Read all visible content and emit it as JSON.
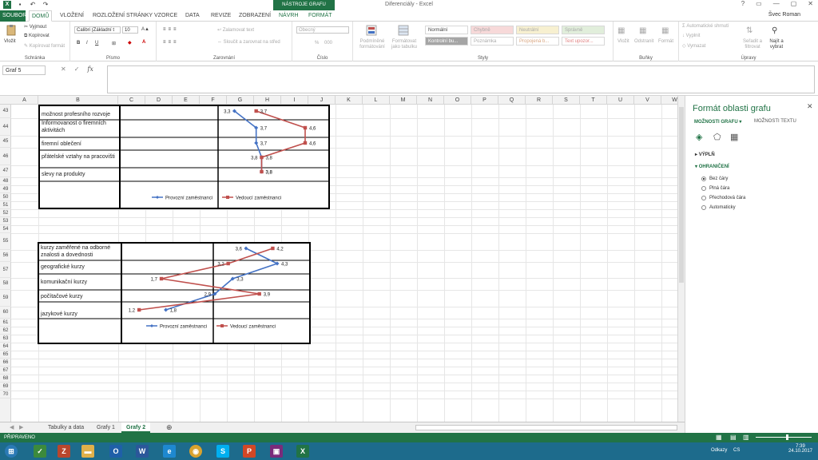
{
  "window": {
    "title": "Diferenciály - Excel",
    "context_tab": "NÁSTROJE GRAFU",
    "user": "Švec Roman",
    "controls": [
      "?",
      "▭",
      "—",
      "▢",
      "✕"
    ]
  },
  "tabs": [
    {
      "label": "SOUBOR"
    },
    {
      "label": "DOMŮ"
    },
    {
      "label": "VLOŽENÍ"
    },
    {
      "label": "ROZLOŽENÍ STRÁNKY"
    },
    {
      "label": "VZORCE"
    },
    {
      "label": "DATA"
    },
    {
      "label": "REVIZE"
    },
    {
      "label": "ZOBRAZENÍ"
    },
    {
      "label": "NÁVRH"
    },
    {
      "label": "FORMÁT"
    }
  ],
  "ribbon": {
    "clipboard": {
      "label": "Schránka",
      "paste": "Vložit",
      "cut": "Vyjmout",
      "copy": "Kopírovat",
      "format_painter": "Kopírovat formát"
    },
    "font": {
      "label": "Písmo",
      "name": "Calibri (Základní t",
      "size": "10",
      "bold": "B",
      "italic": "I",
      "underline": "U"
    },
    "alignment": {
      "label": "Zarovnání",
      "wrap": "Zalamovat text",
      "merge": "Sloučit a zarovnat na střed"
    },
    "number": {
      "label": "Číslo",
      "format": "Obecný",
      "percent": "%",
      "thousands": "000"
    },
    "styles": {
      "label": "Styly",
      "conditional": "Podmíněné formátování",
      "as_table": "Formátovat jako tabulku",
      "cells": [
        "Normální",
        "Chybně",
        "Neutrální",
        "Správně",
        "Kontrolní bu...",
        "Poznámka",
        "Propojená b...",
        "Text upozor..."
      ]
    },
    "cells_group": {
      "label": "Buňky",
      "insert": "Vložit",
      "delete": "Odstranit",
      "format": "Formát"
    },
    "editing": {
      "label": "Úpravy",
      "autosum": "Automatické shrnutí",
      "fill": "Vyplnit",
      "clear": "Vymazat",
      "sort": "Seřadit a filtrovat",
      "find": "Najít a vybrat"
    }
  },
  "formula_bar": {
    "name_box": "Graf 5",
    "fx": "fx",
    "cancel": "✕",
    "enter": "✓",
    "formula": ""
  },
  "columns": [
    "A",
    "B",
    "C",
    "D",
    "E",
    "F",
    "G",
    "H",
    "I",
    "J",
    "K",
    "L",
    "M",
    "N",
    "O",
    "P",
    "Q",
    "R",
    "S",
    "T",
    "U",
    "V",
    "W"
  ],
  "rows": [
    "43",
    "44",
    "45",
    "46",
    "47",
    "48",
    "49",
    "50",
    "51",
    "52",
    "53",
    "54",
    "55",
    "56",
    "57",
    "58",
    "59",
    "60",
    "61",
    "62",
    "63",
    "64",
    "65",
    "66",
    "67",
    "68",
    "69",
    "70"
  ],
  "chart_data": [
    {
      "type": "line",
      "categories": [
        "možnost profesního rozvoje",
        "Informovanost o firemních aktivitách",
        "firemní oblečení",
        "přátelské vztahy na pracovišti",
        "slevy na produkty"
      ],
      "series": [
        {
          "name": "Provozní zaměstnanci",
          "color": "#4472c4",
          "values": [
            3.3,
            3.7,
            3.7,
            3.8,
            3.8
          ]
        },
        {
          "name": "Vedoucí zaměstnanci",
          "color": "#c0504d",
          "values": [
            3.7,
            4.6,
            4.6,
            3.8,
            3.8
          ]
        }
      ],
      "data_labels": {
        "s0": [
          "3,3",
          "3,7",
          "3,7",
          "3,8",
          "3,8"
        ],
        "s1": [
          "3,7",
          "4,6",
          "4,6",
          "3,8",
          "3,8"
        ]
      },
      "legend": "bottom"
    },
    {
      "type": "line",
      "categories": [
        "kurzy zaměřené na odborné znalosti a dovednosti",
        "geografické kurzy",
        "komunikační kurzy",
        "počítačové kurzy",
        "jazykové kurzy"
      ],
      "series": [
        {
          "name": "Provozní zaměstnanci",
          "color": "#4472c4",
          "values": [
            3.6,
            4.3,
            3.3,
            2.9,
            1.8
          ]
        },
        {
          "name": "Vedoucí zaměstnanci",
          "color": "#c0504d",
          "values": [
            4.2,
            3.2,
            1.7,
            3.9,
            1.2
          ]
        }
      ],
      "data_labels": {
        "s0": [
          "3,6",
          "4,3",
          "3,3",
          "2,9",
          "1,8"
        ],
        "s1": [
          "4,2",
          "3,2",
          "1,7",
          "3,9",
          "1,2"
        ]
      },
      "legend": "bottom"
    }
  ],
  "sheet_tabs": [
    "Tabulky a data",
    "Grafy 1",
    "Grafy 2"
  ],
  "active_sheet": "Grafy 2",
  "pane": {
    "title": "Formát oblasti grafu",
    "tab_chart": "MOŽNOSTI GRAFU",
    "tab_text": "MOŽNOSTI TEXTU",
    "fill_section": "VÝPLŇ",
    "border_section": "OHRANIČENÍ",
    "options": [
      "Bez čáry",
      "Plná čára",
      "Přechodová čára",
      "Automaticky"
    ],
    "selected": "Bez čáry"
  },
  "status": {
    "text": "PŘIPRAVENO"
  },
  "taskbar": {
    "lang": "CS",
    "time": "7:39",
    "date": "24.10.2017",
    "links": "Odkazy"
  }
}
